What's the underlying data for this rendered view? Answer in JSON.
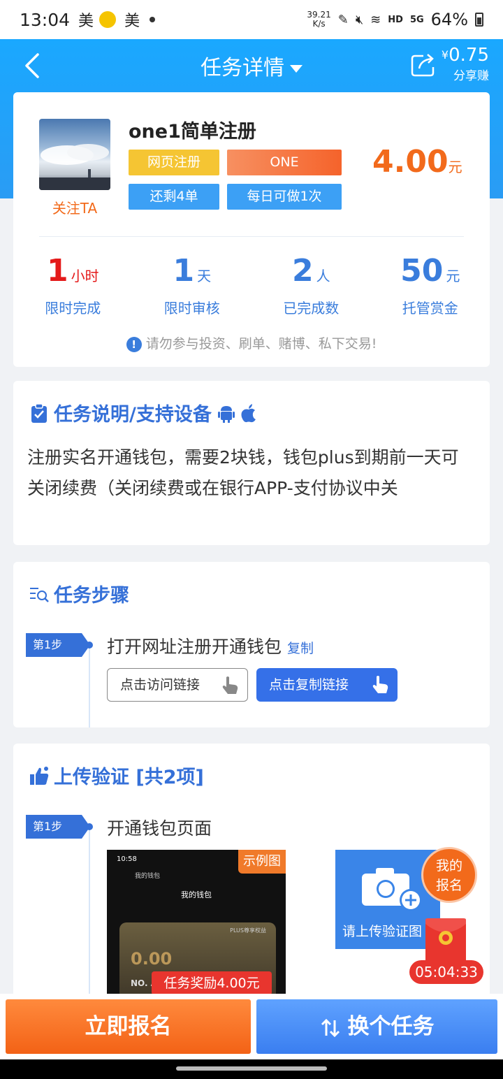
{
  "status_bar": {
    "time": "13:04",
    "app1": "美",
    "app2": "美",
    "speed_value": "39.21",
    "speed_unit": "K/s",
    "network": "HD",
    "signal": "5G",
    "battery": "64%"
  },
  "nav": {
    "title": "任务详情",
    "share_currency": "¥",
    "share_amount": "0.75",
    "share_label": "分享赚"
  },
  "task": {
    "name": "one1简单注册",
    "follow_label": "关注TA",
    "tags": [
      "网页注册",
      "ONE",
      "还剩4单",
      "每日可做1次"
    ],
    "price": "4.00",
    "price_unit": "元",
    "stats": [
      {
        "value": "1",
        "unit": "小时",
        "label": "限时完成"
      },
      {
        "value": "1",
        "unit": "天",
        "label": "限时审核"
      },
      {
        "value": "2",
        "unit": "人",
        "label": "已完成数"
      },
      {
        "value": "50",
        "unit": "元",
        "label": "托管赏金"
      }
    ],
    "warning": "请勿参与投资、刷单、赌博、私下交易!"
  },
  "description": {
    "title": "任务说明/支持设备",
    "text": "注册实名开通钱包，需要2块钱，钱包plus到期前一天可关闭续费（关闭续费或在银行APP-支付协议中关"
  },
  "steps": {
    "title": "任务步骤",
    "step1_badge": "第1步",
    "step1_text": "打开网址注册开通钱包",
    "copy_label": "复制",
    "visit_button": "点击访问链接",
    "copy_button": "点击复制链接"
  },
  "upload": {
    "title": "上传验证 [共2项]",
    "step1_badge": "第1步",
    "step1_text": "开通钱包页面",
    "example_tag": "示例图",
    "example_time": "10:58",
    "example_sub": "我的钱包",
    "example_title": "我的钱包",
    "example_amount": "0.00",
    "example_plus": "PLUS尊享权益",
    "example_no": "NO. A",
    "upload_label": "请上传验证图"
  },
  "reward_tip": "任务奖励4.00元",
  "floating": {
    "register_line1": "我的",
    "register_line2": "报名",
    "timer": "05:04:33"
  },
  "bottom": {
    "signup": "立即报名",
    "switch": "换个任务"
  },
  "colors": {
    "primary_blue": "#3570d8",
    "header_blue": "#1aa8ff",
    "orange": "#f26a1b",
    "red": "#e41a1a"
  }
}
